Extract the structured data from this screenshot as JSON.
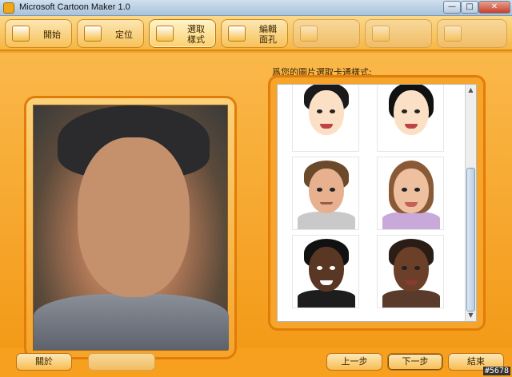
{
  "window": {
    "title": "Microsoft Cartoon Maker 1.0",
    "controls": {
      "minimize": "—",
      "maximize": "□",
      "close": "✕"
    }
  },
  "tabs": [
    {
      "label": "開始",
      "icon": "start-icon",
      "state": "enabled"
    },
    {
      "label": "定位",
      "icon": "locate-icon",
      "state": "enabled"
    },
    {
      "label": "選取\n樣式",
      "icon": "style-grid-icon",
      "state": "active"
    },
    {
      "label": "編輯\n面孔",
      "icon": "edit-face-icon",
      "state": "enabled"
    },
    {
      "label": "",
      "icon": "disabled-tab-icon",
      "state": "disabled"
    },
    {
      "label": "",
      "icon": "disabled-tab-icon",
      "state": "disabled"
    },
    {
      "label": "",
      "icon": "disabled-tab-icon",
      "state": "disabled"
    }
  ],
  "gallery": {
    "prompt": "爲您的圖片選取卡通樣式:",
    "scroll": {
      "up": "▲",
      "down": "▼"
    },
    "styles": [
      {
        "name": "style-girl-short-black-hair"
      },
      {
        "name": "style-girl-bangs-black-hair"
      },
      {
        "name": "style-man-brown-hair"
      },
      {
        "name": "style-woman-long-brown-hair"
      },
      {
        "name": "style-woman-dark-headscarf"
      },
      {
        "name": "style-woman-dark-headband"
      }
    ]
  },
  "buttons": {
    "about": "關於",
    "disabled_middle": "",
    "back": "上一步",
    "next": "下一步",
    "finish": "結束"
  },
  "watermark": "#5678",
  "colors": {
    "accent": "#f39a18",
    "frame": "#e27c08"
  }
}
